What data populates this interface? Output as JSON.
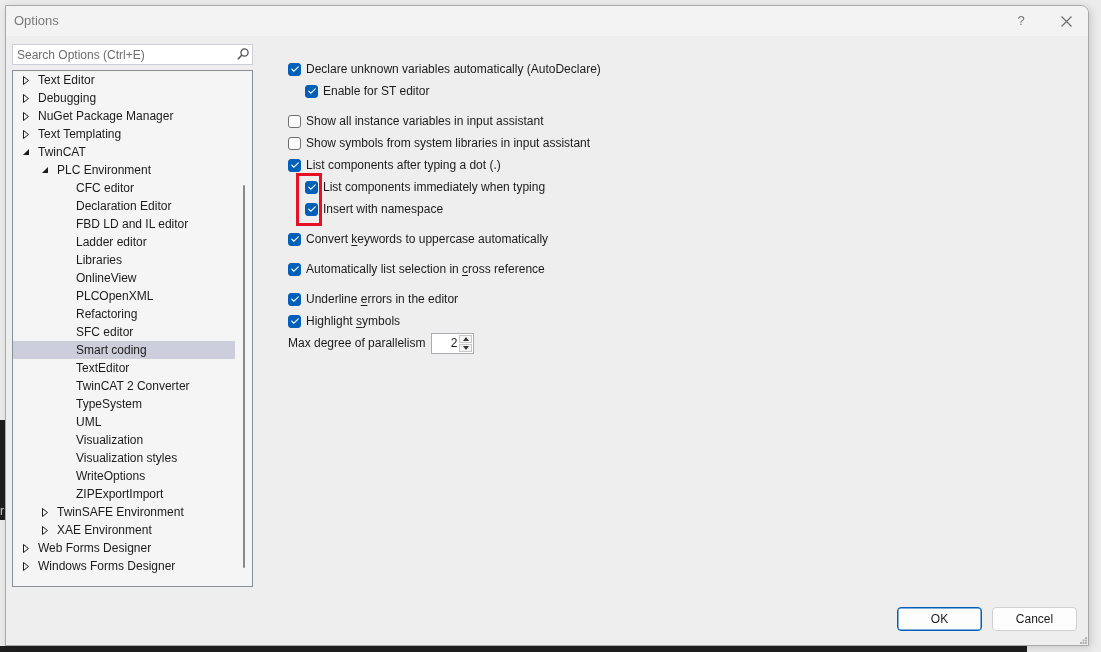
{
  "background": {
    "text": "r"
  },
  "window": {
    "title": "Options",
    "help_button": "?"
  },
  "search": {
    "placeholder": "Search Options (Ctrl+E)"
  },
  "tree": [
    {
      "label": "Text Editor",
      "expanded": false,
      "selected": false
    },
    {
      "label": "Debugging",
      "expanded": false,
      "selected": false
    },
    {
      "label": "NuGet Package Manager",
      "expanded": false,
      "selected": false
    },
    {
      "label": "Text Templating",
      "expanded": false,
      "selected": false
    },
    {
      "label": "TwinCAT",
      "expanded": true,
      "selected": false,
      "children": [
        {
          "label": "PLC Environment",
          "expanded": true,
          "selected": false,
          "children": [
            {
              "label": "CFC editor",
              "selected": false
            },
            {
              "label": "Declaration Editor",
              "selected": false
            },
            {
              "label": "FBD LD and IL editor",
              "selected": false
            },
            {
              "label": "Ladder editor",
              "selected": false
            },
            {
              "label": "Libraries",
              "selected": false
            },
            {
              "label": "OnlineView",
              "selected": false
            },
            {
              "label": "PLCOpenXML",
              "selected": false
            },
            {
              "label": "Refactoring",
              "selected": false
            },
            {
              "label": "SFC editor",
              "selected": false
            },
            {
              "label": "Smart coding",
              "selected": true
            },
            {
              "label": "TextEditor",
              "selected": false
            },
            {
              "label": "TwinCAT 2 Converter",
              "selected": false
            },
            {
              "label": "TypeSystem",
              "selected": false
            },
            {
              "label": "UML",
              "selected": false
            },
            {
              "label": "Visualization",
              "selected": false
            },
            {
              "label": "Visualization styles",
              "selected": false
            },
            {
              "label": "WriteOptions",
              "selected": false
            },
            {
              "label": "ZIPExportImport",
              "selected": false
            }
          ]
        },
        {
          "label": "TwinSAFE Environment",
          "expanded": false,
          "selected": false
        },
        {
          "label": "XAE Environment",
          "expanded": false,
          "selected": false
        }
      ]
    },
    {
      "label": "Web Forms Designer",
      "expanded": false,
      "selected": false
    },
    {
      "label": "Windows Forms Designer",
      "expanded": false,
      "selected": false
    }
  ],
  "option_groups": [
    [
      {
        "kind": "checkbox",
        "label": "Declare unknown variables automatically (AutoDeclare)",
        "checked": true,
        "children": [
          {
            "kind": "checkbox",
            "label": "Enable for ST editor",
            "checked": true
          }
        ]
      }
    ],
    [
      {
        "kind": "checkbox",
        "label": "Show all instance variables in input assistant",
        "checked": false
      },
      {
        "kind": "checkbox",
        "label": "Show symbols from system libraries in input assistant",
        "checked": false
      },
      {
        "kind": "checkbox",
        "label": "List components after typing a dot (.)",
        "checked": true,
        "children_highlighted": true,
        "children": [
          {
            "kind": "checkbox",
            "label": "List components immediately when typing",
            "checked": true
          },
          {
            "kind": "checkbox",
            "label": "Insert with namespace",
            "checked": true
          }
        ]
      }
    ],
    [
      {
        "kind": "checkbox",
        "label": [
          {
            "text": "Convert ",
            "underlined": false
          },
          {
            "text": "k",
            "underlined": true
          },
          {
            "text": "eywords to uppercase automatically",
            "underlined": false
          }
        ],
        "checked": true
      }
    ],
    [
      {
        "kind": "checkbox",
        "label": [
          {
            "text": "Automatically list selection in ",
            "underlined": false
          },
          {
            "text": "c",
            "underlined": true
          },
          {
            "text": "ross reference",
            "underlined": false
          }
        ],
        "checked": true
      }
    ],
    [
      {
        "kind": "checkbox",
        "label": [
          {
            "text": "Underline ",
            "underlined": false
          },
          {
            "text": "e",
            "underlined": true
          },
          {
            "text": "rrors in the editor",
            "underlined": false
          }
        ],
        "checked": true
      },
      {
        "kind": "checkbox",
        "label": [
          {
            "text": "Highlight ",
            "underlined": false
          },
          {
            "text": "s",
            "underlined": true
          },
          {
            "text": "ymbols",
            "underlined": false
          }
        ],
        "checked": true
      },
      {
        "kind": "spinner",
        "label": "Max degree of parallelism",
        "value": "2"
      }
    ]
  ],
  "buttons": [
    {
      "label": "OK",
      "default": true
    },
    {
      "label": "Cancel",
      "default": false
    }
  ]
}
